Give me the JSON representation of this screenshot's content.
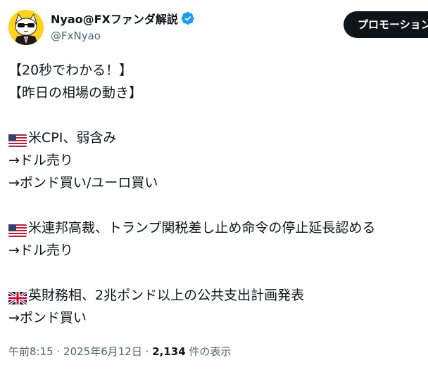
{
  "author": {
    "display_name": "Nyao@FXファンダ解説",
    "handle": "@FxNyao",
    "verified_icon": "verified-badge-icon",
    "avatar_icon": "cat-with-sunglasses-avatar"
  },
  "promote_button": {
    "label": "プロモーション"
  },
  "tweet": {
    "line1": "【20秒でわかる！】",
    "line2": "【昨日の相場の動き】",
    "item1_flag": "us-flag-icon",
    "item1_title": "米CPI、弱含み",
    "item1_sub1": "→ドル売り",
    "item1_sub2": "→ポンド買い/ユーロ買い",
    "item2_flag": "us-flag-icon",
    "item2_title": "米連邦高裁、トランプ関税差し止め命令の停止延長認める",
    "item2_sub1": "→ドル売り",
    "item3_flag": "uk-flag-icon",
    "item3_title": "英財務相、2兆ポンド以上の公共支出計画発表",
    "item3_sub1": "→ポンド買い"
  },
  "meta": {
    "time": "午前8:15",
    "separator": "·",
    "date": "2025年6月12日",
    "view_count": "2,134",
    "view_label": "件の表示"
  },
  "colors": {
    "text": "#0f1419",
    "secondary": "#536471",
    "verified": "#1d9bf0",
    "button_bg": "#0f1419",
    "avatar_bg": "#ffd21f"
  }
}
